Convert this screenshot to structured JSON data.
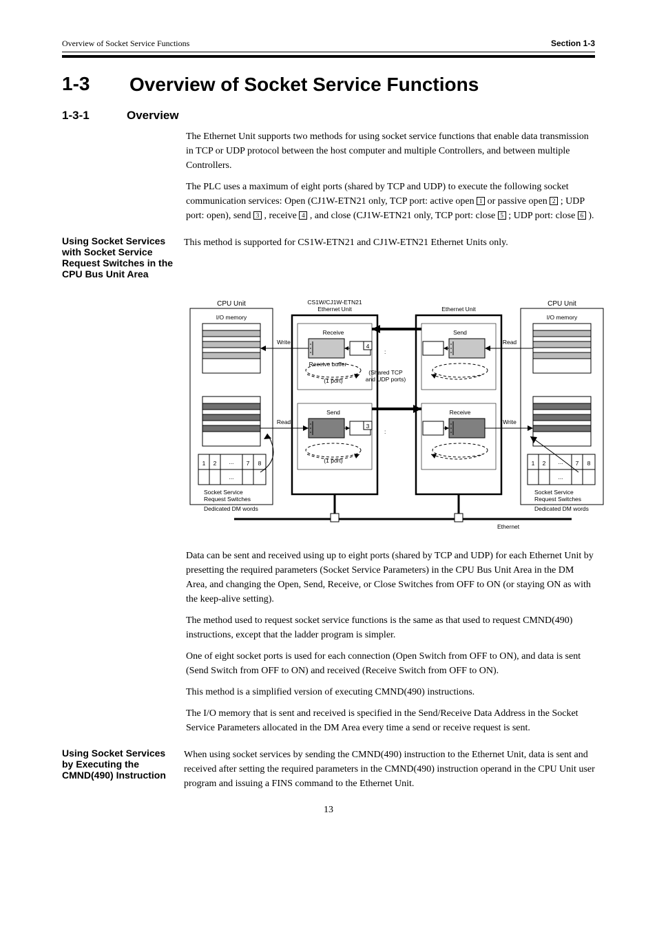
{
  "header": {
    "left": "Overview of Socket Service Functions",
    "right": "Section 1-3"
  },
  "section": {
    "number": "1-3",
    "title": "Overview of Socket Service Functions"
  },
  "sub1": {
    "number": "1-3-1",
    "title": "Overview"
  },
  "intro": {
    "p1": "The Ethernet Unit supports two methods for using socket service functions that enable data transmission in TCP or UDP protocol between the host computer and multiple Controllers, and between multiple Controllers.",
    "p2_parts": [
      "The PLC uses a maximum of eight ports (shared by TCP and UDP) to execute the following socket communication services: Open (CJ1W-ETN21 only, TCP port: active open",
      " or passive open",
      "; UDP port: open), send",
      ", receive",
      ", and close (CJ1W-ETN21 only, TCP port: close",
      "; UDP port: close",
      ")."
    ],
    "squares": [
      "1",
      "2",
      "3",
      "4",
      "5",
      "6"
    ]
  },
  "feature1": {
    "label": "Using Socket Services with Socket Service Request Switches in the CPU Bus Unit Area",
    "p": "This method is supported for CS1W-ETN21 and CJ1W-ETN21 Ethernet Units only."
  },
  "diagram": {
    "left_box_title": "CPU Unit",
    "right_box_title": "CPU Unit",
    "left_eth_title": "CS1W/CJ1W-ETN21\nEthernet Unit",
    "right_eth_title": "Ethernet Unit",
    "io_area": "I/O memory",
    "socket_svc": "Socket Service\nRequest Switches",
    "dm_label": "Dedicated DM words",
    "receive": "Receive",
    "receive_buf": "Receive buffer",
    "send": "Send",
    "write": "Write",
    "read": "Read",
    "ethernet": "Ethernet",
    "one_port": "(1 port)",
    "shared_ports": "(Shared TCP\nand UDP ports)",
    "num1": "1",
    "num2": "2",
    "num7": "7",
    "num8": "8",
    "sq3": "3",
    "sq4": "4"
  },
  "below": {
    "p1": "Data can be sent and received using up to eight ports (shared by TCP and UDP) for each Ethernet Unit by presetting the required parameters (Socket Service Parameters) in the CPU Bus Unit Area in the DM Area, and changing the Open, Send, Receive, or Close Switches from OFF to ON (or staying ON as with the keep-alive setting).",
    "p2": "The method used to request socket service functions is the same as that used to request CMND(490) instructions, except that the ladder program is simpler.",
    "p3": "One of eight socket ports is used for each connection (Open Switch from OFF to ON), and data is sent (Send Switch from OFF to ON) and received (Receive Switch from OFF to ON).",
    "p4": "This method is a simplified version of executing CMND(490) instructions.",
    "p5": "The I/O memory that is sent and received is specified in the Send/Receive Data Address in the Socket Service Parameters allocated in the DM Area every time a send or receive request is sent."
  },
  "feature2": {
    "label": "Using Socket Services by Executing the CMND(490) Instruction",
    "p": "When using socket services by sending the CMND(490) instruction to the Ethernet Unit, data is sent and received after setting the required parameters in the CMND(490) instruction operand in the CPU Unit user program and issuing a FINS command to the Ethernet Unit."
  },
  "page_number": "13"
}
